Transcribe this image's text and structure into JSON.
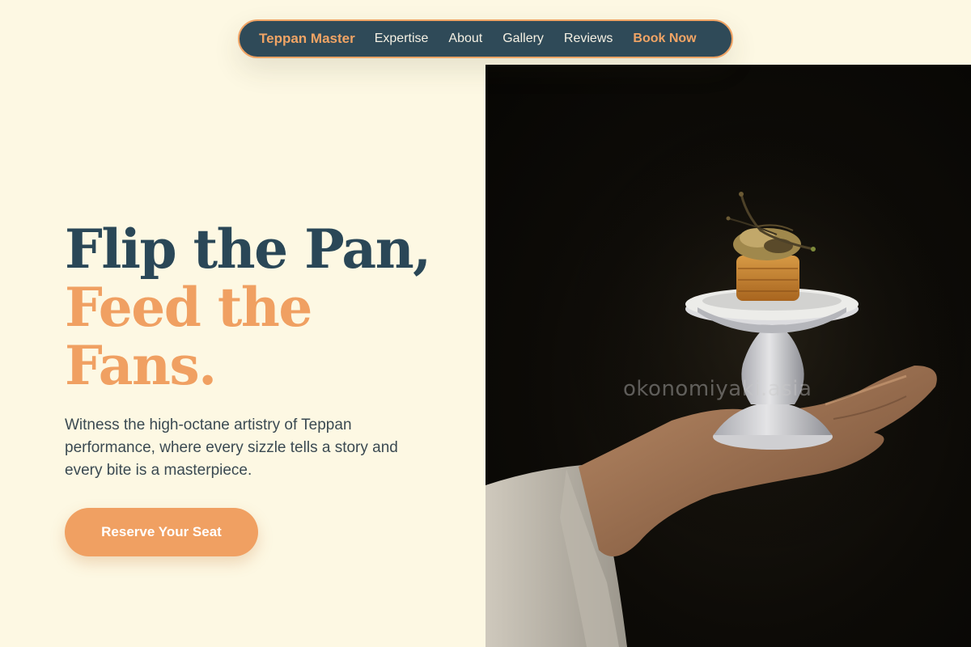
{
  "nav": {
    "brand": "Teppan Master",
    "links": [
      "Expertise",
      "About",
      "Gallery",
      "Reviews"
    ],
    "cta": "Book Now"
  },
  "hero": {
    "title_line1": "Flip the Pan,",
    "title_line2": "Feed the",
    "title_line3": "Fans.",
    "subtitle": "Witness the high-octane artistry of Teppan performance, where every sizzle tells a story and every bite is a masterpiece.",
    "cta": "Reserve Your Seat"
  },
  "image": {
    "watermark": "okonomiyaki.asia"
  },
  "colors": {
    "background": "#fdf8e3",
    "navy": "#2f4a58",
    "accent": "#f0a062",
    "text": "#3b4a52"
  }
}
